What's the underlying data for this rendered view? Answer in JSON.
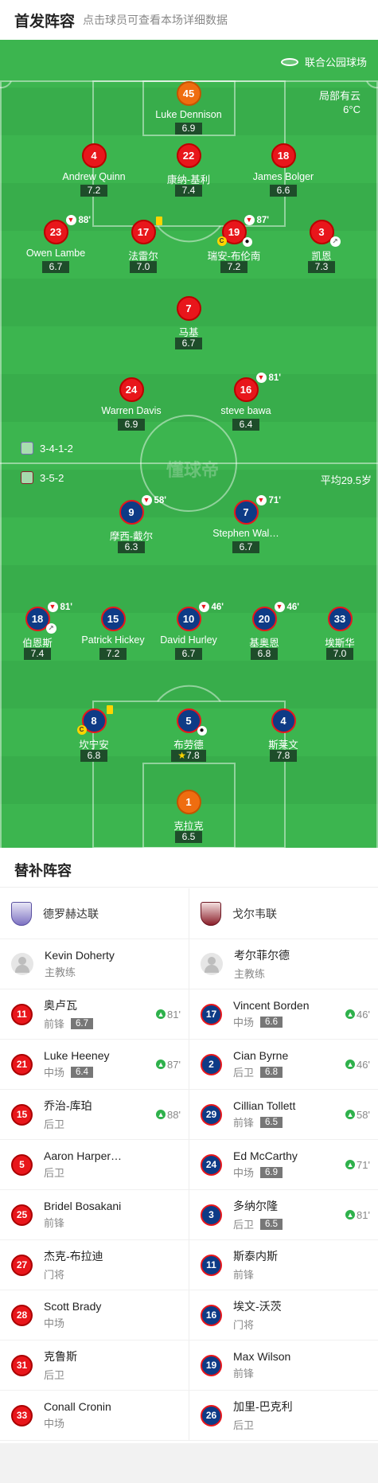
{
  "header": {
    "title": "首发阵容",
    "subtitle": "点击球员可查看本场详细数据"
  },
  "pitch": {
    "venue": "联合公园球场",
    "weather": "局部有云",
    "temperature": "6°C",
    "home_formation": "3-4-1-2",
    "away_formation": "3-5-2",
    "away_avg_age": "平均29.5岁",
    "watermark": "懂球帝"
  },
  "home_players": [
    {
      "num": "45",
      "name": "Luke Dennison",
      "rating": "6.9",
      "gk": true
    },
    {
      "num": "4",
      "name": "Andrew Quinn",
      "rating": "7.2"
    },
    {
      "num": "22",
      "name": "康纳-基利",
      "rating": "7.4"
    },
    {
      "num": "18",
      "name": "James Bolger",
      "rating": "6.6"
    },
    {
      "num": "23",
      "name": "Owen Lambe",
      "rating": "6.7",
      "sub_time": "88'"
    },
    {
      "num": "17",
      "name": "法雷尔",
      "rating": "7.0"
    },
    {
      "num": "19",
      "name": "瑞安-布伦南",
      "rating": "7.2",
      "sub_time": "87'"
    },
    {
      "num": "3",
      "name": "凯恩",
      "rating": "7.3"
    },
    {
      "num": "7",
      "name": "马基",
      "rating": "6.7"
    },
    {
      "num": "24",
      "name": "Warren Davis",
      "rating": "6.9"
    },
    {
      "num": "16",
      "name": "steve bawa",
      "rating": "6.4",
      "sub_time": "81'"
    }
  ],
  "away_players": [
    {
      "num": "9",
      "name": "摩西-戴尔",
      "rating": "6.3",
      "sub_time": "58'"
    },
    {
      "num": "7",
      "name": "Stephen Wal…",
      "rating": "6.7",
      "sub_time": "71'"
    },
    {
      "num": "18",
      "name": "伯恩斯",
      "rating": "7.4",
      "sub_time": "81'"
    },
    {
      "num": "15",
      "name": "Patrick Hickey",
      "rating": "7.2"
    },
    {
      "num": "10",
      "name": "David Hurley",
      "rating": "6.7",
      "sub_time": "46'"
    },
    {
      "num": "20",
      "name": "基奥恩",
      "rating": "6.8",
      "sub_time": "46'"
    },
    {
      "num": "33",
      "name": "埃斯华",
      "rating": "7.0"
    },
    {
      "num": "8",
      "name": "坎宁安",
      "rating": "6.8"
    },
    {
      "num": "5",
      "name": "布劳德",
      "rating": "7.8"
    },
    {
      "num": "4",
      "name": "斯莱文",
      "rating": "7.8"
    },
    {
      "num": "1",
      "name": "克拉克",
      "rating": "6.5",
      "gk": true
    }
  ],
  "subs_title": "替补阵容",
  "home_team": {
    "name": "德罗赫达联",
    "coach": {
      "name": "Kevin Doherty",
      "role": "主教练"
    },
    "subs": [
      {
        "num": "11",
        "name": "奥卢瓦",
        "pos": "前锋",
        "rating": "6.7",
        "on": "81'"
      },
      {
        "num": "21",
        "name": "Luke Heeney",
        "pos": "中场",
        "rating": "6.4",
        "on": "87'"
      },
      {
        "num": "15",
        "name": "乔治-库珀",
        "pos": "后卫",
        "rating": "",
        "on": "88'"
      },
      {
        "num": "5",
        "name": "Aaron Harper…",
        "pos": "后卫",
        "rating": "",
        "on": ""
      },
      {
        "num": "25",
        "name": "Bridel Bosakani",
        "pos": "前锋",
        "rating": "",
        "on": ""
      },
      {
        "num": "27",
        "name": "杰克-布拉迪",
        "pos": "门将",
        "rating": "",
        "on": ""
      },
      {
        "num": "28",
        "name": "Scott Brady",
        "pos": "中场",
        "rating": "",
        "on": ""
      },
      {
        "num": "31",
        "name": "克鲁斯",
        "pos": "后卫",
        "rating": "",
        "on": ""
      },
      {
        "num": "33",
        "name": "Conall Cronin",
        "pos": "中场",
        "rating": "",
        "on": ""
      }
    ]
  },
  "away_team": {
    "name": "戈尔韦联",
    "coach": {
      "name": "考尔菲尔德",
      "role": "主教练"
    },
    "subs": [
      {
        "num": "17",
        "name": "Vincent Borden",
        "pos": "中场",
        "rating": "6.6",
        "on": "46'"
      },
      {
        "num": "2",
        "name": "Cian Byrne",
        "pos": "后卫",
        "rating": "6.8",
        "on": "46'"
      },
      {
        "num": "29",
        "name": "Cillian Tollett",
        "pos": "前锋",
        "rating": "6.5",
        "on": "58'"
      },
      {
        "num": "24",
        "name": "Ed McCarthy",
        "pos": "中场",
        "rating": "6.9",
        "on": "71'"
      },
      {
        "num": "3",
        "name": "多纳尔隆",
        "pos": "后卫",
        "rating": "6.5",
        "on": "81'"
      },
      {
        "num": "11",
        "name": "斯泰内斯",
        "pos": "前锋",
        "rating": "",
        "on": ""
      },
      {
        "num": "16",
        "name": "埃文-沃茨",
        "pos": "门将",
        "rating": "",
        "on": ""
      },
      {
        "num": "19",
        "name": "Max Wilson",
        "pos": "前锋",
        "rating": "",
        "on": ""
      },
      {
        "num": "26",
        "name": "加里-巴克利",
        "pos": "后卫",
        "rating": "",
        "on": ""
      }
    ]
  }
}
